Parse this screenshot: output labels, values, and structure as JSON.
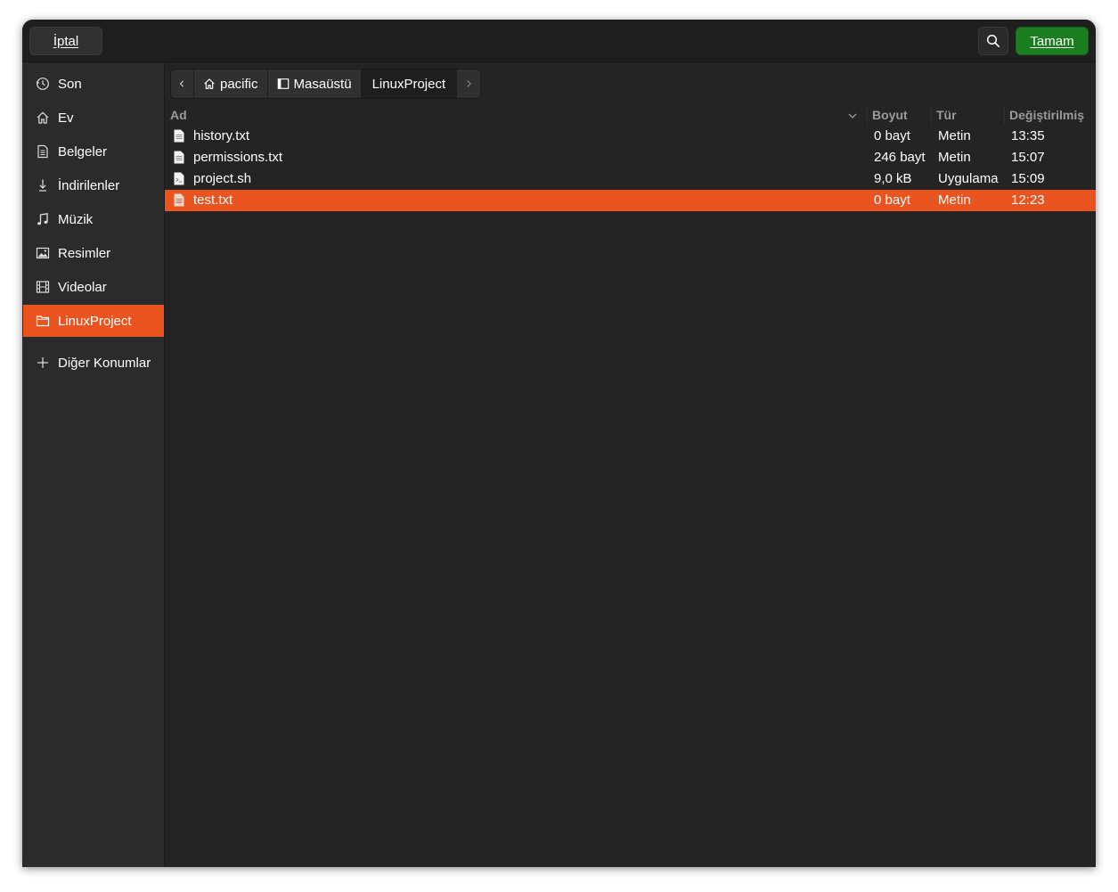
{
  "header": {
    "cancel_label": "İptal",
    "ok_label": "Tamam"
  },
  "sidebar": {
    "items": [
      {
        "label": "Son",
        "icon": "clock-icon"
      },
      {
        "label": "Ev",
        "icon": "home-icon"
      },
      {
        "label": "Belgeler",
        "icon": "document-icon"
      },
      {
        "label": "İndirilenler",
        "icon": "download-icon"
      },
      {
        "label": "Müzik",
        "icon": "music-icon"
      },
      {
        "label": "Resimler",
        "icon": "picture-icon"
      },
      {
        "label": "Videolar",
        "icon": "film-icon"
      },
      {
        "label": "LinuxProject",
        "icon": "folder-icon",
        "active": true
      }
    ],
    "other_locations": "Diğer Konumlar"
  },
  "pathbar": {
    "crumbs": [
      "pacific",
      "Masaüstü",
      "LinuxProject"
    ]
  },
  "columns": {
    "name": "Ad",
    "size": "Boyut",
    "type": "Tür",
    "modified": "Değiştirilmiş"
  },
  "files": [
    {
      "name": "history.txt",
      "size": "0 bayt",
      "type": "Metin",
      "modified": "13:35"
    },
    {
      "name": "permissions.txt",
      "size": "246 bayt",
      "type": "Metin",
      "modified": "15:07"
    },
    {
      "name": "project.sh",
      "size": "9,0 kB",
      "type": "Uygulama",
      "modified": "15:09"
    },
    {
      "name": "test.txt",
      "size": "0 bayt",
      "type": "Metin",
      "modified": "12:23",
      "selected": true
    }
  ],
  "colors": {
    "accent": "#e95420",
    "ok_button": "#1b7d1f",
    "window_bg": "#242424",
    "sidebar_bg": "#2b2b2b"
  }
}
